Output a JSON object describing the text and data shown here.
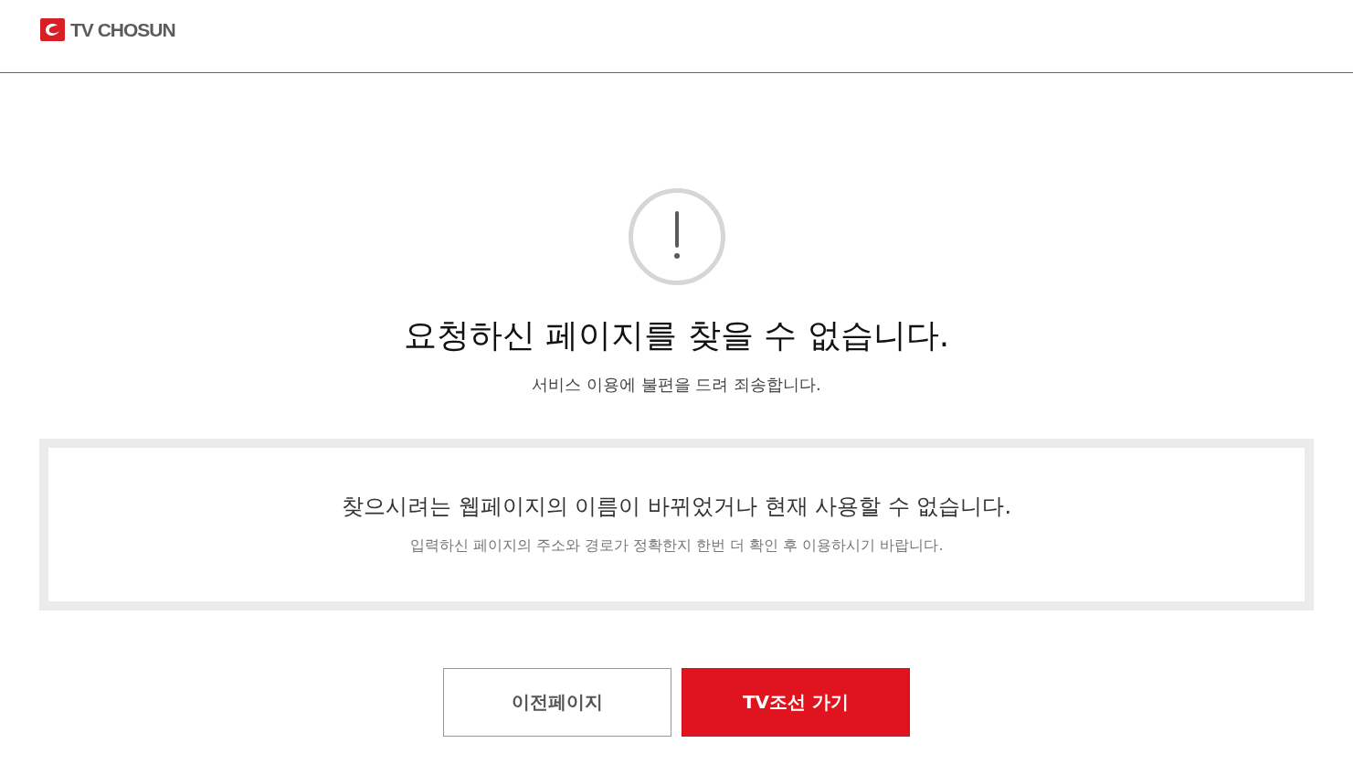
{
  "header": {
    "logo_text": "TV CHOSUN"
  },
  "message": {
    "title": "요청하신 페이지를 찾을 수 없습니다.",
    "subtitle": "서비스 이용에 불편을 드려 죄송합니다."
  },
  "notice": {
    "heading": "찾으시려는 웹페이지의 이름이 바뀌었거나 현재 사용할 수 없습니다.",
    "detail": "입력하신 페이지의 주소와 경로가 정확한지 한번 더 확인 후 이용하시기 바랍니다."
  },
  "buttons": [
    {
      "label": "이전페이지",
      "kind": "secondary"
    },
    {
      "label": "TV조선 가기",
      "kind": "primary"
    }
  ]
}
